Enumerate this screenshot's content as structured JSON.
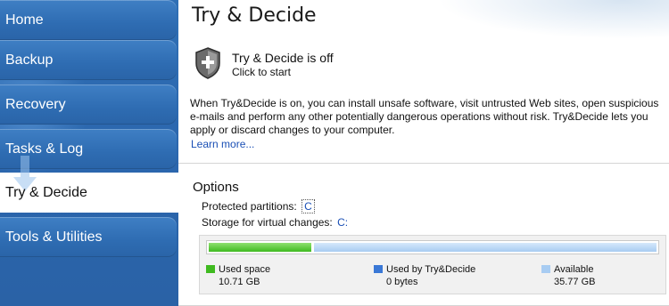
{
  "sidebar": {
    "items": [
      {
        "label": "Home"
      },
      {
        "label": "Backup"
      },
      {
        "label": "Recovery"
      },
      {
        "label": "Tasks & Log"
      },
      {
        "label": "Try & Decide"
      },
      {
        "label": "Tools & Utilities"
      }
    ],
    "active_index": 4
  },
  "page": {
    "title": "Try & Decide"
  },
  "status": {
    "icon": "shield-icon",
    "title": "Try & Decide is off",
    "subtitle": "Click to start"
  },
  "description": "When Try&Decide is on, you can install unsafe software, visit untrusted Web sites, open suspicious e-mails and perform any other potentially dangerous operations without risk. Try&Decide lets you apply or discard changes to your computer.",
  "learn_more": "Learn more...",
  "options": {
    "title": "Options",
    "protected_label": "Protected partitions:",
    "protected_value": "C",
    "storage_label": "Storage for virtual changes:",
    "storage_value": "C:"
  },
  "storage": {
    "used_fraction": 0.23,
    "legend": [
      {
        "label": "Used space",
        "value": "10.71 GB",
        "color": "#3fba20"
      },
      {
        "label": "Used by Try&Decide",
        "value": "0 bytes",
        "color": "#3a78d6"
      },
      {
        "label": "Available",
        "value": "35.77 GB",
        "color": "#a8ccf2"
      }
    ]
  },
  "colors": {
    "sidebar": "#2f6fb5",
    "link": "#1a4fb5"
  }
}
